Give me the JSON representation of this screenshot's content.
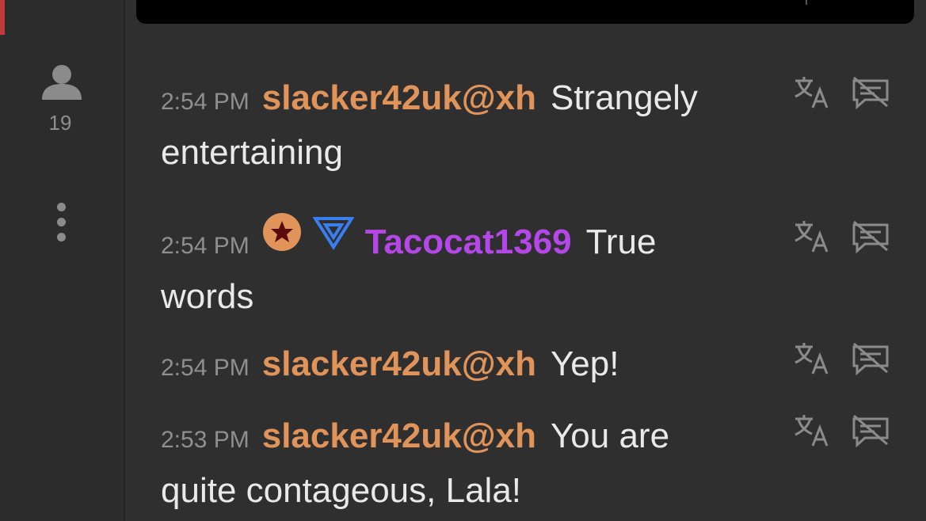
{
  "sidebar": {
    "viewer_count": "19",
    "viewer_icon": "person-icon",
    "more_icon": "vertical-ellipsis-icon"
  },
  "colors": {
    "background": "#2f2f2f",
    "sidebar": "#2c2c2c",
    "accent_red": "#c0393b",
    "username_orange": "#e0945a",
    "username_purple": "#b547e8",
    "message_text": "#e9e9e9",
    "timestamp": "#8f8f8f",
    "icon_gray": "#8b8b8b"
  },
  "messages": [
    {
      "time": "2:54 PM",
      "user": "slacker42uk@xh",
      "line1": "Strangely",
      "line2": "entertaining"
    },
    {
      "time": "2:54 PM",
      "user": "Tacocat1369",
      "line1": "True",
      "line2": "words",
      "badges": [
        "star-badge-icon",
        "blue-triangle-badge-icon"
      ]
    },
    {
      "time": "2:54 PM",
      "user": "slacker42uk@xh",
      "line1": "Yep!",
      "line2": ""
    },
    {
      "time": "2:53 PM",
      "user": "slacker42uk@xh",
      "line1": "You are",
      "line2": "quite contageous, Lala!"
    }
  ],
  "action_icons": [
    "translate-icon",
    "hide-message-icon"
  ]
}
